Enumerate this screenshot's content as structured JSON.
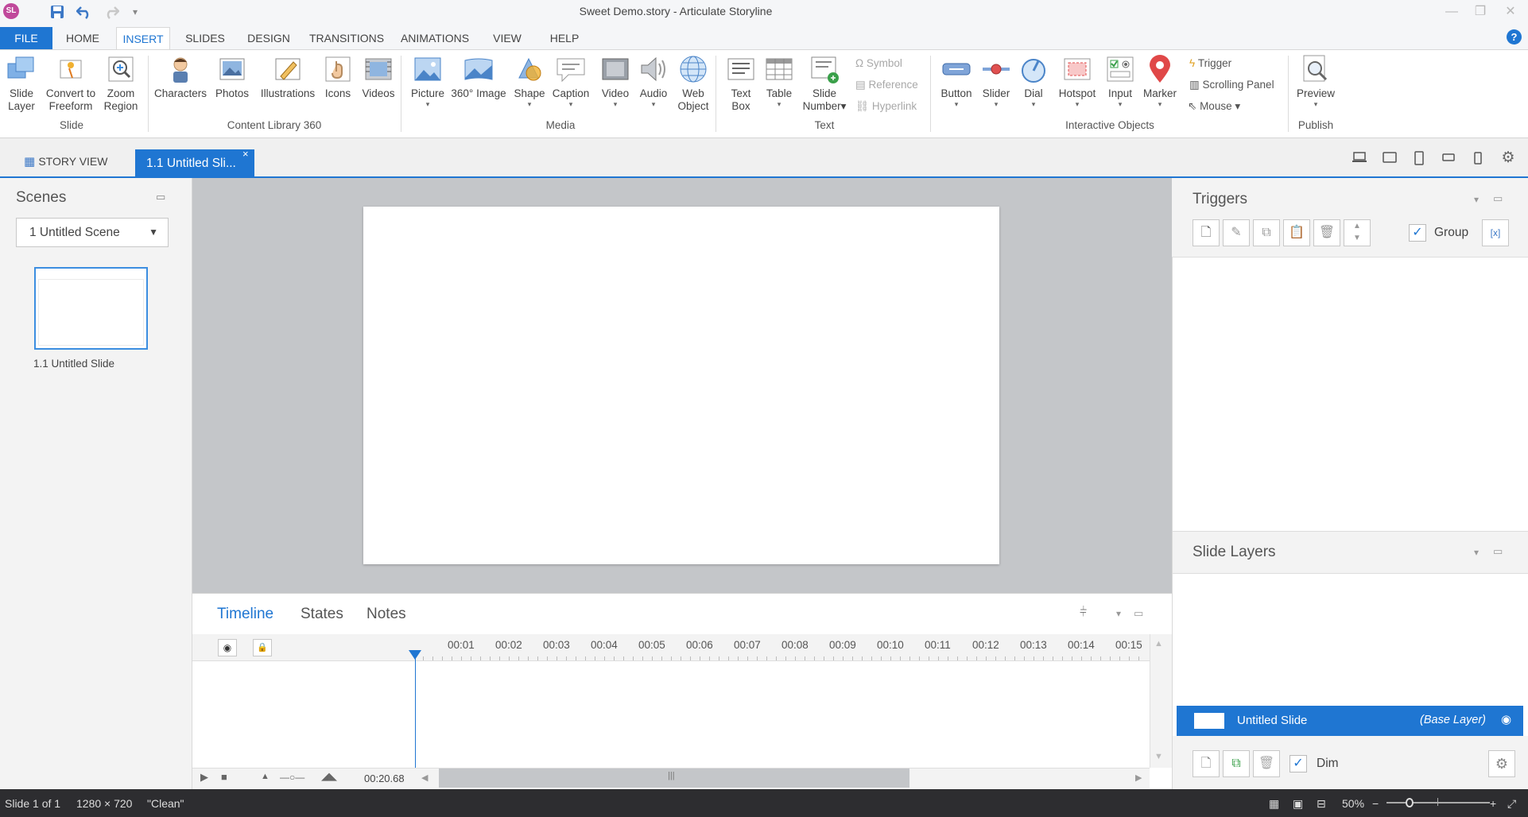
{
  "app": {
    "logo": "SL",
    "window_title": "Sweet Demo.story - Articulate Storyline",
    "accent": "#1f76d2"
  },
  "quick_access": {
    "save_icon": "save-icon",
    "undo_icon": "undo-icon",
    "redo_icon": "redo-icon",
    "customize_icon": "customize-qat-icon"
  },
  "menu_tabs": [
    "FILE",
    "HOME",
    "INSERT",
    "SLIDES",
    "DESIGN",
    "TRANSITIONS",
    "ANIMATIONS",
    "VIEW",
    "HELP"
  ],
  "ribbon": {
    "slide": {
      "group": "Slide",
      "slide_layer": [
        "Slide",
        "Layer"
      ],
      "convert": [
        "Convert to",
        "Freeform"
      ],
      "zoom": [
        "Zoom",
        "Region"
      ]
    },
    "content_library": {
      "group": "Content Library 360",
      "characters": "Characters",
      "photos": "Photos",
      "illustrations": "Illustrations",
      "icons": "Icons",
      "videos": "Videos"
    },
    "media": {
      "group": "Media",
      "picture": "Picture",
      "image360": "360° Image",
      "shape": "Shape",
      "caption": "Caption",
      "video": "Video",
      "audio": "Audio",
      "web_object": [
        "Web",
        "Object"
      ]
    },
    "text": {
      "group": "Text",
      "text_box": [
        "Text",
        "Box"
      ],
      "table": "Table",
      "slide_number": [
        "Slide",
        "Number"
      ],
      "symbol": "Symbol",
      "reference": "Reference",
      "hyperlink": "Hyperlink"
    },
    "interactive": {
      "group": "Interactive Objects",
      "button": "Button",
      "slider": "Slider",
      "dial": "Dial",
      "hotspot": "Hotspot",
      "input": "Input",
      "marker": "Marker",
      "trigger": "Trigger",
      "scrolling_panel": "Scrolling Panel",
      "mouse": "Mouse"
    },
    "publish": {
      "group": "Publish",
      "preview": "Preview"
    }
  },
  "view_tabs": {
    "story_view": "STORY VIEW",
    "slide_tab": "1.1 Untitled Sli...",
    "close": "×"
  },
  "scenes": {
    "title": "Scenes",
    "selected_scene": "1 Untitled Scene",
    "thumb_label": "1.1 Untitled Slide"
  },
  "timeline": {
    "tabs": [
      "Timeline",
      "States",
      "Notes"
    ],
    "ticks": [
      "00:01",
      "00:02",
      "00:03",
      "00:04",
      "00:05",
      "00:06",
      "00:07",
      "00:08",
      "00:09",
      "00:10",
      "00:11",
      "00:12",
      "00:13",
      "00:14",
      "00:15"
    ],
    "duration": "00:20.68"
  },
  "triggers": {
    "title": "Triggers",
    "group_label": "Group",
    "group_checked": true
  },
  "slide_layers": {
    "title": "Slide Layers",
    "base_layer_name": "Untitled Slide",
    "base_layer_tag": "(Base Layer)",
    "dim_label": "Dim",
    "dim_checked": true
  },
  "statusbar": {
    "slide_pos": "Slide 1 of 1",
    "size": "1280 × 720",
    "theme": "\"Clean\"",
    "zoom": "50%"
  }
}
